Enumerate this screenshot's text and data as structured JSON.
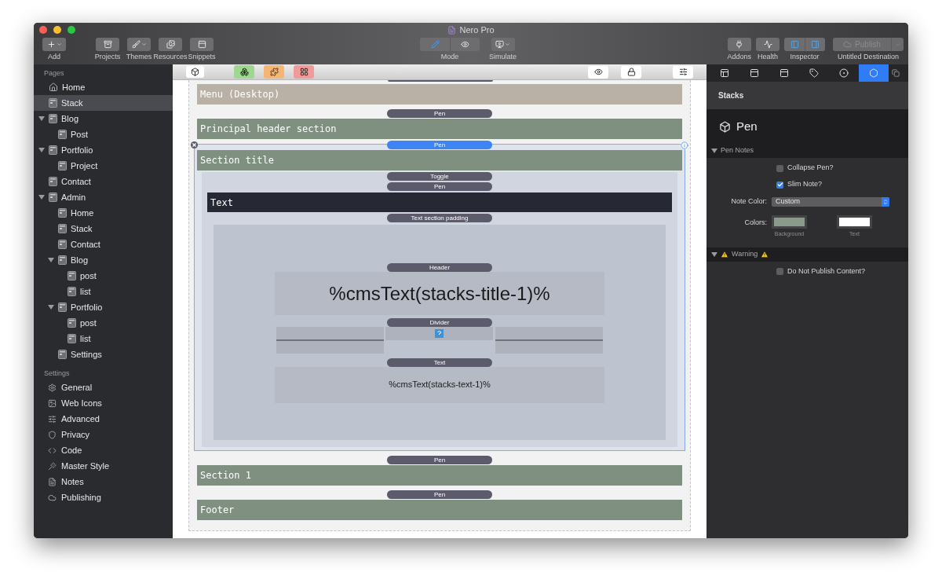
{
  "window": {
    "title": "Nero Pro"
  },
  "toolbar": {
    "left": [
      {
        "label": "Add",
        "menu": true
      },
      {
        "label": "Projects",
        "menu": false
      },
      {
        "label": "Themes",
        "menu": true
      },
      {
        "label": "Resources",
        "menu": false
      },
      {
        "label": "Snippets",
        "menu": false
      }
    ],
    "mode": {
      "label": "Mode",
      "segments": [
        {
          "selected": true
        },
        {
          "selected": false
        }
      ]
    },
    "simulate": {
      "label": "Simulate",
      "menu": true
    },
    "right": [
      {
        "label": "Addons"
      },
      {
        "label": "Health"
      }
    ],
    "inspector": {
      "label": "Inspector",
      "segments": [
        {
          "selected": true
        },
        {
          "selected": true
        }
      ]
    },
    "publish": {
      "label": "Publish",
      "disabled": true,
      "destination": "Untitled Destination"
    }
  },
  "sidebar": {
    "pages_heading": "Pages",
    "pages": [
      {
        "label": "Home",
        "kind": "home",
        "selected": false
      },
      {
        "label": "Stack",
        "kind": "page",
        "selected": true
      },
      {
        "label": "Blog",
        "kind": "page",
        "selected": false,
        "expanded": true,
        "children": [
          {
            "label": "Post",
            "kind": "page",
            "selected": false
          }
        ]
      },
      {
        "label": "Portfolio",
        "kind": "page",
        "selected": false,
        "expanded": true,
        "children": [
          {
            "label": "Project",
            "kind": "page",
            "selected": false
          }
        ]
      },
      {
        "label": "Contact",
        "kind": "page",
        "selected": false
      },
      {
        "label": "Admin",
        "kind": "page",
        "selected": false,
        "expanded": true,
        "children": [
          {
            "label": "Home",
            "kind": "page",
            "selected": false
          },
          {
            "label": "Stack",
            "kind": "page",
            "selected": false
          },
          {
            "label": "Contact",
            "kind": "page",
            "selected": false
          },
          {
            "label": "Blog",
            "kind": "page",
            "selected": false,
            "expanded": true,
            "children": [
              {
                "label": "post",
                "kind": "page",
                "selected": false
              },
              {
                "label": "list",
                "kind": "page",
                "selected": false
              }
            ]
          },
          {
            "label": "Portfolio",
            "kind": "page",
            "selected": false,
            "expanded": true,
            "children": [
              {
                "label": "post",
                "kind": "page",
                "selected": false
              },
              {
                "label": "list",
                "kind": "page",
                "selected": false
              }
            ]
          },
          {
            "label": "Settings",
            "kind": "page",
            "selected": false
          }
        ]
      }
    ],
    "settings_heading": "Settings",
    "settings": [
      {
        "label": "General"
      },
      {
        "label": "Web Icons"
      },
      {
        "label": "Advanced"
      },
      {
        "label": "Privacy"
      },
      {
        "label": "Code"
      },
      {
        "label": "Master Style"
      },
      {
        "label": "Notes"
      },
      {
        "label": "Publishing"
      }
    ]
  },
  "canvas": {
    "sections": [
      {
        "label": "Menu (Desktop)",
        "color": "#b9b0a6",
        "selected": false
      },
      {
        "pen": "Pen",
        "label": "Principal header section",
        "color": "#7f8f80",
        "selected": false
      },
      {
        "pen": "Pen",
        "label": "Section title",
        "color": "#7f8f80",
        "selected": true,
        "toggle": "Toggle",
        "inner_pen": "Pen",
        "text_bar": "Text",
        "padding_label": "Text section padding",
        "header_label": "Header",
        "header_text": "%cmsText(stacks-title-1)%",
        "divider_label": "Divider",
        "text_label": "Text",
        "body_text": "%cmsText(stacks-text-1)%"
      },
      {
        "pen": "Pen",
        "label": "Section 1",
        "color": "#7f8f80",
        "selected": false
      },
      {
        "pen": "Pen",
        "label": "Footer",
        "color": "#7f8f80",
        "selected": false
      }
    ]
  },
  "inspector": {
    "tabs": [
      {
        "selected": false
      },
      {
        "selected": false
      },
      {
        "selected": false
      },
      {
        "selected": false
      },
      {
        "selected": false
      },
      {
        "selected": true
      }
    ],
    "heading": "Stacks",
    "title": "Pen",
    "groups": [
      {
        "label": "Pen Notes",
        "expanded": true,
        "warning": false,
        "rows": [
          {
            "kind": "checkbox",
            "label": "Collapse Pen?",
            "checked": false
          },
          {
            "kind": "checkbox",
            "label": "Slim Note?",
            "checked": true
          },
          {
            "kind": "select",
            "label": "Note Color:",
            "value": "Custom"
          },
          {
            "kind": "colors",
            "label": "Colors:",
            "swatches": [
              {
                "label": "Background",
                "color": "#8a9a8b"
              },
              {
                "label": "Text",
                "color": "#ffffff"
              }
            ]
          }
        ]
      },
      {
        "label": "Warning",
        "expanded": true,
        "warning": true,
        "rows": [
          {
            "kind": "checkbox",
            "label": "Do Not Publish Content?",
            "checked": false
          }
        ]
      }
    ]
  }
}
